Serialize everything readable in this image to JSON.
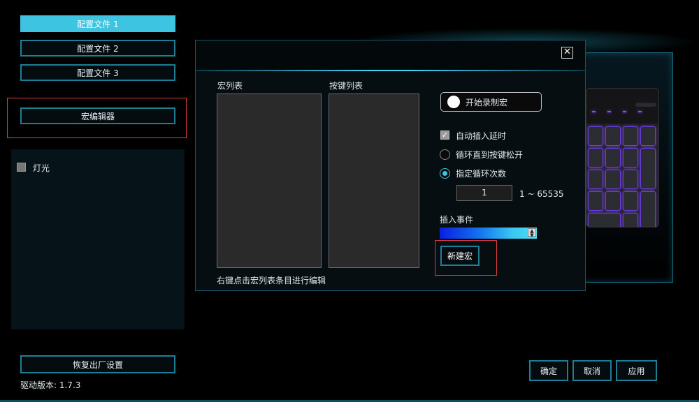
{
  "sidebar": {
    "profiles": [
      "配置文件 1",
      "配置文件 2",
      "配置文件 3"
    ],
    "macro_editor_label": "宏编辑器",
    "lighting_label": "灯光",
    "factory_reset_label": "恢复出厂设置",
    "driver_version_label": "驱动版本:  1.7.3"
  },
  "dialog": {
    "close_label": "✕",
    "macro_list_label": "宏列表",
    "key_list_label": "按键列表",
    "hint": "右键点击宏列表条目进行编辑",
    "record_label": "开始录制宏",
    "auto_delay_label": "自动插入延时",
    "loop_until_release_label": "循环直到按键松开",
    "loop_count_label": "指定循环次数",
    "loop_count_value": "1",
    "loop_range_label": "1 ~ 65535",
    "insert_event_label": "插入事件",
    "new_macro_label": "新建宏",
    "options": {
      "auto_delay_checked": true,
      "loop_until_release_selected": false,
      "loop_count_selected": true
    }
  },
  "footer": {
    "ok_label": "确定",
    "cancel_label": "取消",
    "apply_label": "应用"
  },
  "colors": {
    "accent": "#3cc4e0",
    "border": "#1d7e96",
    "highlight_red": "#e03a3a",
    "key_glow": "#8a4cff"
  }
}
